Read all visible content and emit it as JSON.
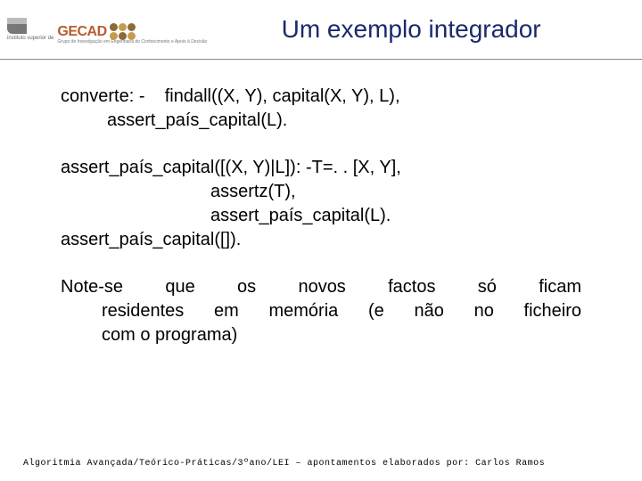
{
  "header": {
    "isep_label": "instituto superior de",
    "gecad_text": "GECAD",
    "gecad_sub": "Grupo de Investigação em Engenharia\ndo Conhecimento e Apoio à Decisão",
    "title": "Um exemplo integrador"
  },
  "code": {
    "b1_l1": "converte: -    findall((X, Y), capital(X, Y), L),",
    "b1_l2": "assert_país_capital(L).",
    "b2_l1": "assert_país_capital([(X, Y)|L]): -T=. . [X, Y],",
    "b2_l2": "assertz(T),",
    "b2_l3": "assert_país_capital(L).",
    "b2_l4": "assert_país_capital([])."
  },
  "note": {
    "line1": "Note-se que os novos factos só ficam",
    "line2": "residentes em memória (e não no ficheiro",
    "line3": "com o programa)"
  },
  "footer": "Algoritmia Avançada/Teórico-Práticas/3ºano/LEI – apontamentos elaborados por: Carlos Ramos"
}
